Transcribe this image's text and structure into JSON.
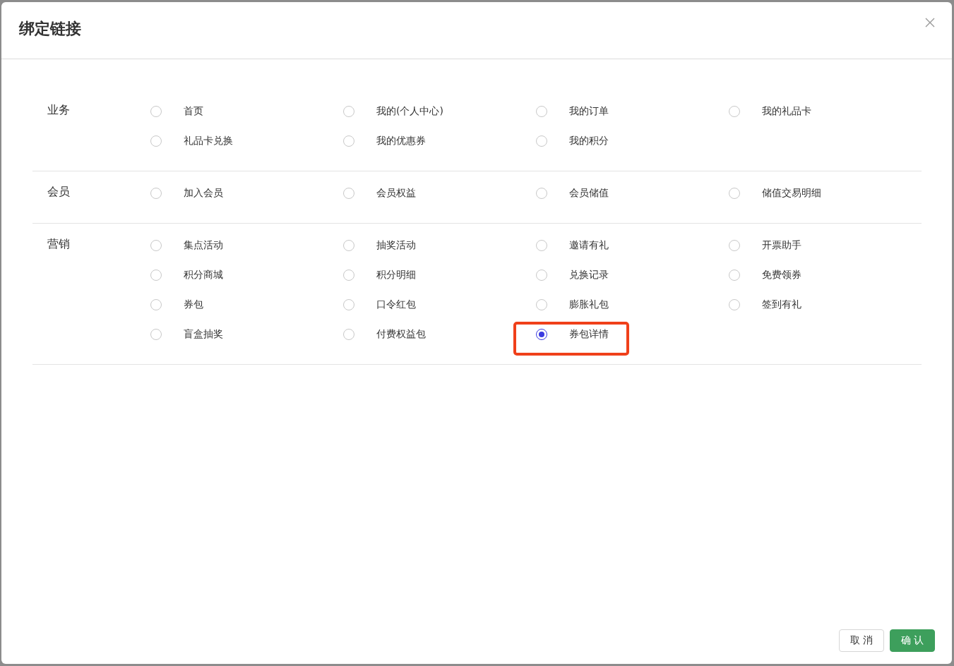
{
  "dialog": {
    "title": "绑定链接"
  },
  "sections": [
    {
      "label": "业务",
      "options": [
        {
          "label": "首页",
          "selected": false,
          "highlighted": false
        },
        {
          "label": "我的(个人中心)",
          "selected": false,
          "highlighted": false
        },
        {
          "label": "我的订单",
          "selected": false,
          "highlighted": false
        },
        {
          "label": "我的礼品卡",
          "selected": false,
          "highlighted": false
        },
        {
          "label": "礼品卡兑换",
          "selected": false,
          "highlighted": false
        },
        {
          "label": "我的优惠券",
          "selected": false,
          "highlighted": false
        },
        {
          "label": "我的积分",
          "selected": false,
          "highlighted": false
        }
      ]
    },
    {
      "label": "会员",
      "options": [
        {
          "label": "加入会员",
          "selected": false,
          "highlighted": false
        },
        {
          "label": "会员权益",
          "selected": false,
          "highlighted": false
        },
        {
          "label": "会员储值",
          "selected": false,
          "highlighted": false
        },
        {
          "label": "储值交易明细",
          "selected": false,
          "highlighted": false
        }
      ]
    },
    {
      "label": "营销",
      "options": [
        {
          "label": "集点活动",
          "selected": false,
          "highlighted": false
        },
        {
          "label": "抽奖活动",
          "selected": false,
          "highlighted": false
        },
        {
          "label": "邀请有礼",
          "selected": false,
          "highlighted": false
        },
        {
          "label": "开票助手",
          "selected": false,
          "highlighted": false
        },
        {
          "label": "积分商城",
          "selected": false,
          "highlighted": false
        },
        {
          "label": "积分明细",
          "selected": false,
          "highlighted": false
        },
        {
          "label": "兑换记录",
          "selected": false,
          "highlighted": false
        },
        {
          "label": "免费领券",
          "selected": false,
          "highlighted": false
        },
        {
          "label": "券包",
          "selected": false,
          "highlighted": false
        },
        {
          "label": "口令红包",
          "selected": false,
          "highlighted": false
        },
        {
          "label": "膨胀礼包",
          "selected": false,
          "highlighted": false
        },
        {
          "label": "签到有礼",
          "selected": false,
          "highlighted": false
        },
        {
          "label": "盲盒抽奖",
          "selected": false,
          "highlighted": false
        },
        {
          "label": "付费权益包",
          "selected": false,
          "highlighted": false
        },
        {
          "label": "券包详情",
          "selected": true,
          "highlighted": true
        }
      ]
    }
  ],
  "buttons": {
    "cancel": "取 消",
    "confirm": "确 认"
  }
}
